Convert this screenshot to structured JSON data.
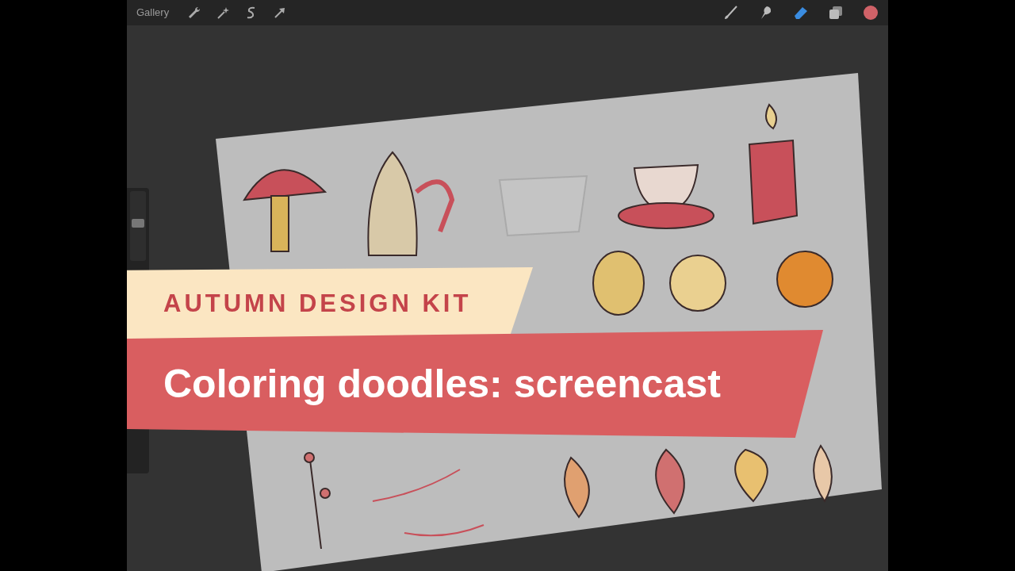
{
  "toolbar": {
    "gallery_label": "Gallery"
  },
  "brush_size_slider": {
    "level": 0.55
  },
  "banners": {
    "subtitle": "AUTUMN DESIGN KIT",
    "title": "Coloring doodles: screencast"
  }
}
